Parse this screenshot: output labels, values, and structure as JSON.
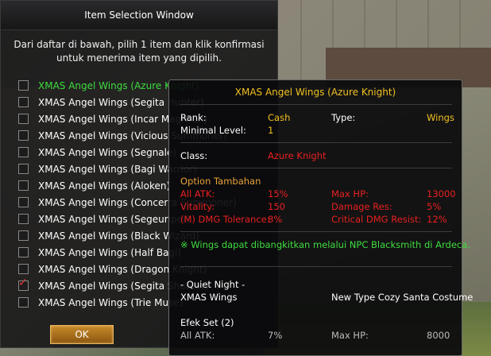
{
  "window": {
    "title": "Item Selection Window",
    "message": "Dari daftar di bawah, pilih 1 item dan klik konfirmasi untuk menerima item yang dipilih.",
    "ok_label": "OK"
  },
  "items": [
    {
      "label": "XMAS Angel Wings (Azure Knight)",
      "checked": false,
      "highlighted": true
    },
    {
      "label": "XMAS Angel Wings (Segita Hunter)",
      "checked": false
    },
    {
      "label": "XMAS Angel Wings (Incar Magician)",
      "checked": false
    },
    {
      "label": "XMAS Angel Wings (Vicious Summoner)",
      "checked": false
    },
    {
      "label": "XMAS Angel Wings (Segnale)",
      "checked": false
    },
    {
      "label": "XMAS Angel Wings (Bagi Warrior)",
      "checked": false
    },
    {
      "label": "XMAS Angel Wings (Aloken)",
      "checked": false
    },
    {
      "label": "XMAS Angel Wings (Concerra Summoner)",
      "checked": false
    },
    {
      "label": "XMAS Angel Wings (Segeuriper)",
      "checked": false
    },
    {
      "label": "XMAS Angel Wings (Black Wizard)",
      "checked": false
    },
    {
      "label": "XMAS Angel Wings (Half Bagi)",
      "checked": false
    },
    {
      "label": "XMAS Angel Wings (Dragon Knight)",
      "checked": false
    },
    {
      "label": "XMAS Angel Wings (Segita Shooter)",
      "checked": true
    },
    {
      "label": "XMAS Angel Wings (Trie Muse)",
      "checked": false
    }
  ],
  "tooltip": {
    "title": "XMAS Angel Wings (Azure Knight)",
    "rank_label": "Rank:",
    "rank_value": "Cash",
    "type_label": "Type:",
    "type_value": "Wings",
    "min_level_label": "Minimal Level:",
    "min_level_value": "1",
    "class_label": "Class:",
    "class_value": "Azure Knight",
    "options_header": "Option Tambahan",
    "all_atk_label": "All ATK:",
    "all_atk_value": "15%",
    "max_hp_label": "Max HP:",
    "max_hp_value": "13000",
    "vitality_label": "Vitality:",
    "vitality_value": "150",
    "damage_res_label": "Damage Res:",
    "damage_res_value": "5%",
    "mdmg_tol_label": "(M) DMG Tolerance:",
    "mdmg_tol_value": "8%",
    "crit_resist_label": "Critical DMG Resist:",
    "crit_resist_value": "12%",
    "note": "※ Wings dapat dibangkitkan melalui NPC Blacksmith di Ardeca.",
    "set_line1": "- Quiet Night -",
    "set_line2": "XMAS Wings",
    "set_costume": "New Type Cozy Santa Costume",
    "set_effect_header": "Efek Set (2)",
    "set_all_atk_label": "All ATK:",
    "set_all_atk_value": "7%",
    "set_max_hp_label": "Max HP:",
    "set_max_hp_value": "8000"
  },
  "colors": {
    "title_gold": "#f0c020",
    "stat_red": "#e82020",
    "highlight_green": "#3fdc3f",
    "header_orange": "#e8a23a"
  }
}
